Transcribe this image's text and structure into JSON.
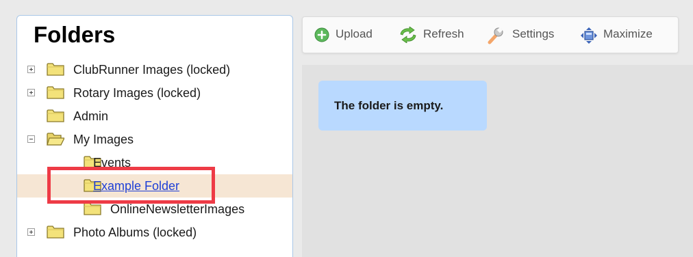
{
  "folders_panel": {
    "title": "Folders",
    "tree": [
      {
        "label": "ClubRunner Images (locked)",
        "expander": "plus",
        "open": false
      },
      {
        "label": "Rotary Images (locked)",
        "expander": "plus",
        "open": false
      },
      {
        "label": "Admin",
        "expander": "none",
        "open": false
      },
      {
        "label": "My Images",
        "expander": "minus",
        "open": true
      },
      {
        "label": "Events",
        "expander": "none",
        "open": false
      },
      {
        "label": "Example Folder",
        "expander": "none",
        "open": false,
        "selected": true
      },
      {
        "label": "OnlineNewsletterImages",
        "expander": "none",
        "open": false
      },
      {
        "label": "Photo Albums (locked)",
        "expander": "plus",
        "open": false
      }
    ]
  },
  "toolbar": {
    "upload_label": "Upload",
    "refresh_label": "Refresh",
    "settings_label": "Settings",
    "maximize_label": "Maximize",
    "icons": {
      "upload": "plus-circle-icon",
      "refresh": "refresh-arrows-icon",
      "settings": "wrench-icon",
      "maximize": "maximize-icon"
    }
  },
  "content": {
    "empty_message": "The folder is empty."
  },
  "colors": {
    "panel_border": "#a9c7e8",
    "selected_row_bg": "#f6e6d4",
    "highlight_box": "#ee3b46",
    "link_text": "#1e3fd6",
    "empty_message_bg": "#b9d9ff",
    "folder_fill": "#f3e27a",
    "folder_stroke": "#8a7a2a"
  }
}
